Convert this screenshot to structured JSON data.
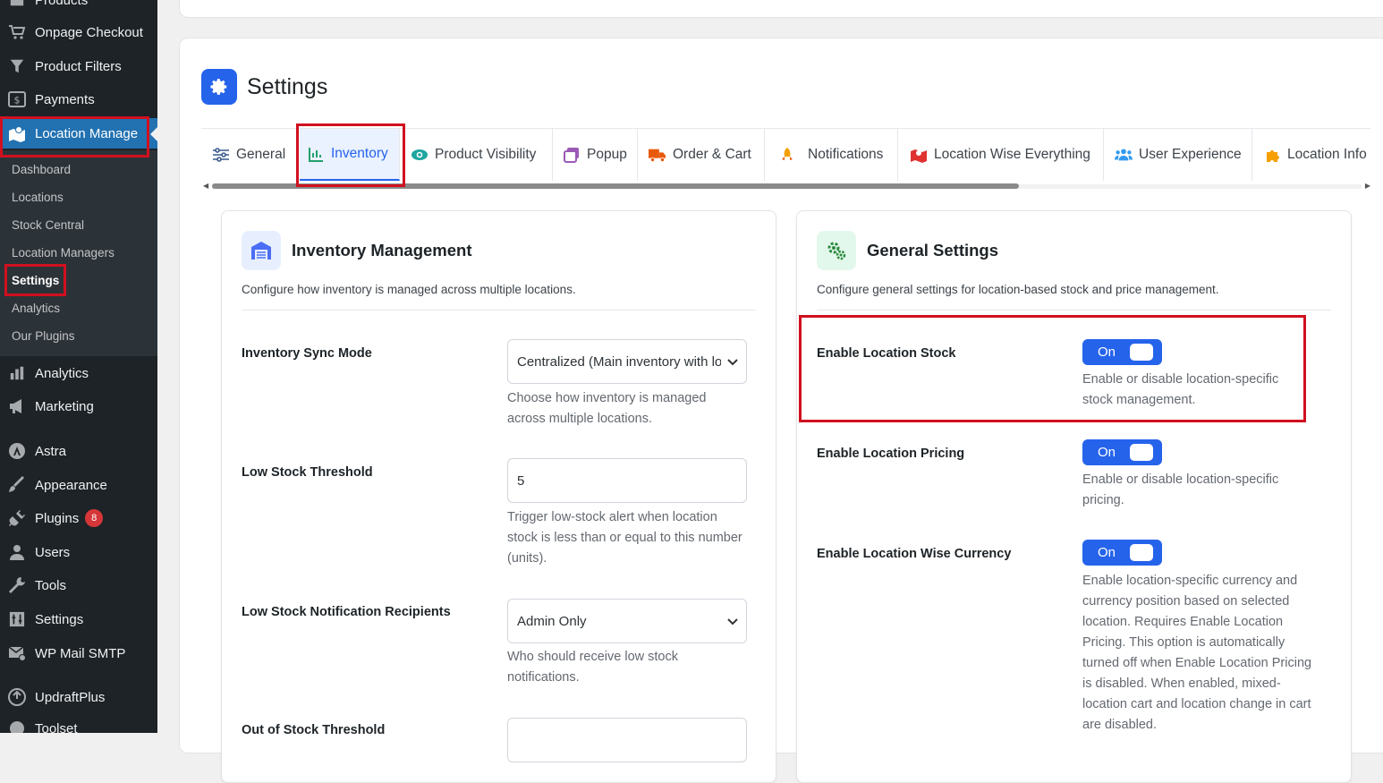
{
  "sidebar": {
    "items_top": [
      {
        "label": "Products",
        "icon": "products-icon"
      },
      {
        "label": "Onpage Checkout",
        "icon": "cart-icon"
      },
      {
        "label": "Product Filters",
        "icon": "filter-icon"
      },
      {
        "label": "Payments",
        "icon": "payments-icon"
      },
      {
        "label": "Location Manage",
        "icon": "location-icon"
      }
    ],
    "submenu": [
      "Dashboard",
      "Locations",
      "Stock Central",
      "Location Managers",
      "Settings",
      "Analytics",
      "Our Plugins"
    ],
    "items_bottom": [
      {
        "label": "Analytics",
        "icon": "analytics-icon"
      },
      {
        "label": "Marketing",
        "icon": "megaphone-icon"
      },
      {
        "label": "Astra",
        "icon": "astra-icon"
      },
      {
        "label": "Appearance",
        "icon": "brush-icon"
      },
      {
        "label": "Plugins",
        "icon": "plugin-icon",
        "badge": "8"
      },
      {
        "label": "Users",
        "icon": "users-icon"
      },
      {
        "label": "Tools",
        "icon": "wrench-icon"
      },
      {
        "label": "Settings",
        "icon": "settings-icon"
      },
      {
        "label": "WP Mail SMTP",
        "icon": "mail-icon"
      },
      {
        "label": "UpdraftPlus",
        "icon": "updraft-icon"
      },
      {
        "label": "Toolset",
        "icon": "toolset-icon"
      }
    ]
  },
  "page": {
    "title": "Settings"
  },
  "tabs": [
    {
      "label": "General",
      "icon": "sliders-icon"
    },
    {
      "label": "Inventory",
      "icon": "chart-icon"
    },
    {
      "label": "Product Visibility",
      "icon": "eye-icon"
    },
    {
      "label": "Popup",
      "icon": "popup-icon"
    },
    {
      "label": "Order & Cart",
      "icon": "truck-icon"
    },
    {
      "label": "Notifications",
      "icon": "rocket-icon"
    },
    {
      "label": "Location Wise Everything",
      "icon": "map-icon"
    },
    {
      "label": "User Experience",
      "icon": "users-icon"
    },
    {
      "label": "Location Info",
      "icon": "puzzle-icon"
    }
  ],
  "inventory": {
    "title": "Inventory Management",
    "description": "Configure how inventory is managed across multiple locations.",
    "sync_mode": {
      "label": "Inventory Sync Mode",
      "value": "Centralized (Main inventory with location allocation)",
      "help": "Choose how inventory is managed across multiple locations."
    },
    "low_stock": {
      "label": "Low Stock Threshold",
      "value": "5",
      "help": "Trigger low-stock alert when location stock is less than or equal to this number (units)."
    },
    "recipients": {
      "label": "Low Stock Notification Recipients",
      "value": "Admin Only",
      "help": "Who should receive low stock notifications."
    },
    "out_of_stock": {
      "label": "Out of Stock Threshold"
    }
  },
  "general": {
    "title": "General Settings",
    "description": "Configure general settings for location-based stock and price management.",
    "location_stock": {
      "label": "Enable Location Stock",
      "toggle": "On",
      "help": "Enable or disable location-specific stock management."
    },
    "location_pricing": {
      "label": "Enable Location Pricing",
      "toggle": "On",
      "help": "Enable or disable location-specific pricing."
    },
    "location_currency": {
      "label": "Enable Location Wise Currency",
      "toggle": "On",
      "help": "Enable location-specific currency and currency position based on selected location. Requires Enable Location Pricing. This option is automatically turned off when Enable Location Pricing is disabled. When enabled, mixed-location cart and location change in cart are disabled."
    }
  },
  "colors": {
    "accent": "#2563eb",
    "highlight": "#d0101f",
    "sidebar_bg": "#1d2327",
    "active_menu": "#2271b1"
  }
}
